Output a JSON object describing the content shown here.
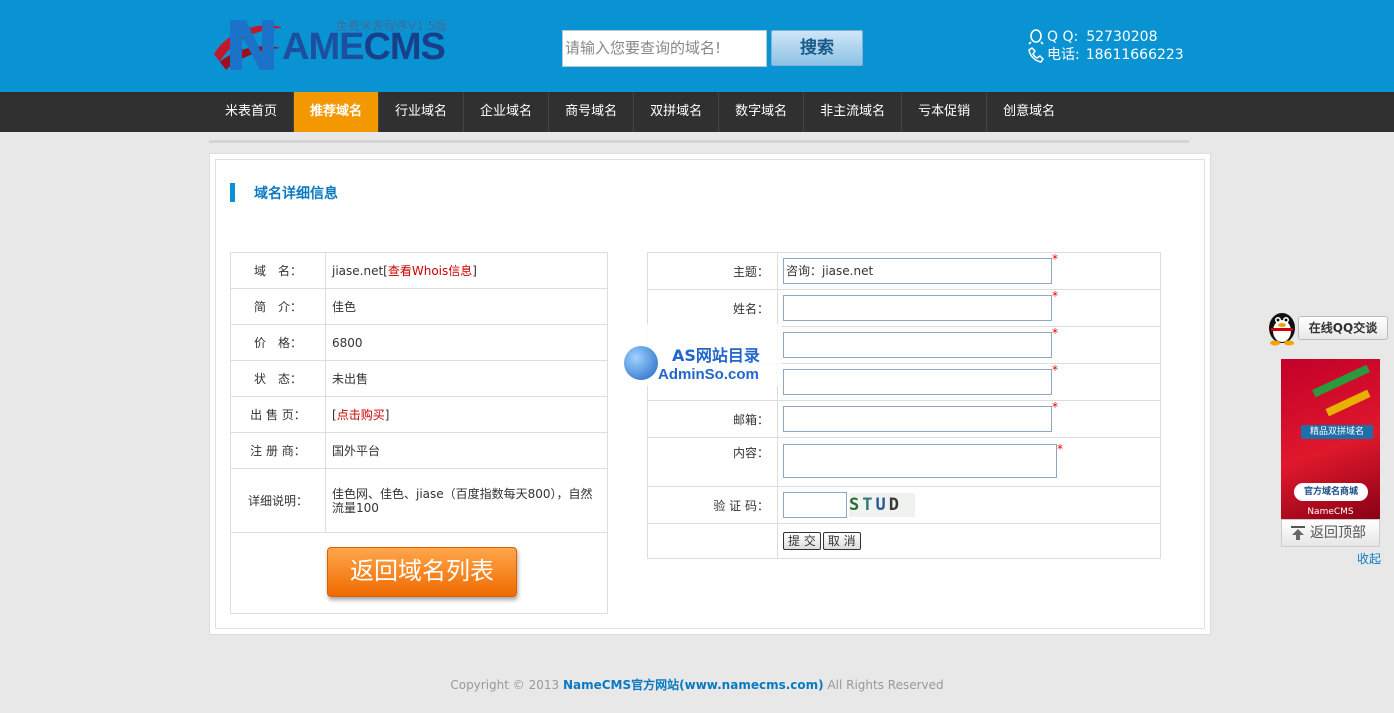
{
  "header": {
    "logo_tagline": "免费米表程序V1.5版",
    "logo_name_a": "AME",
    "logo_name_b": "CMS",
    "search_placeholder": "请输入您要查询的域名!",
    "search_button": "搜索",
    "qq_label": "Q Q:",
    "qq_number": "52730208",
    "phone_label": "电话:",
    "phone_number": "18611666223"
  },
  "nav": [
    {
      "label": "米表首页",
      "active": false
    },
    {
      "label": "推荐域名",
      "active": true
    },
    {
      "label": "行业域名",
      "active": false
    },
    {
      "label": "企业域名",
      "active": false
    },
    {
      "label": "商号域名",
      "active": false
    },
    {
      "label": "双拼域名",
      "active": false
    },
    {
      "label": "数字域名",
      "active": false
    },
    {
      "label": "非主流域名",
      "active": false
    },
    {
      "label": "亏本促销",
      "active": false
    },
    {
      "label": "创意域名",
      "active": false
    }
  ],
  "section_title": "域名详细信息",
  "info": {
    "domain_label": "域　名：",
    "domain_value": "jiase.net",
    "whois_link": "查看Whois信息",
    "intro_label": "简　介：",
    "intro_value": "佳色",
    "price_label": "价　格：",
    "price_value": "6800",
    "status_label": "状　态：",
    "status_value": "未出售",
    "sale_label": "出 售 页：",
    "sale_link": "点击购买",
    "registrar_label": "注 册 商：",
    "registrar_value": "国外平台",
    "detail_label": "详细说明：",
    "detail_value": "佳色网、佳色、jiase（百度指数每天800），自然流量100",
    "back_button": "返回域名列表"
  },
  "form": {
    "subject_label": "主题：",
    "subject_value": "咨询：jiase.net",
    "name_label": "姓名：",
    "email_label": "邮箱：",
    "content_label": "内容：",
    "captcha_label": "验 证 码：",
    "captcha_chars": [
      "S",
      "T",
      "U",
      "D"
    ],
    "required_mark": "*",
    "submit_button": "提 交",
    "cancel_button": "取 消"
  },
  "watermark": {
    "line1": "AS网站目录",
    "line2": "AdminSo.com"
  },
  "float": {
    "qq_chat_label": "在线QQ交谈",
    "ad_sign": "精品双拼域名",
    "ad_button": "官方域名商城",
    "ad_footer": "NameCMS",
    "back_to_top": "返回顶部",
    "collapse": "收起"
  },
  "footer": {
    "prefix": "Copyright © 2013 ",
    "brand": "NameCMS官方网站(www.namecms.com)",
    "suffix": " All Rights Reserved"
  },
  "colors": {
    "header_bg": "#0a93d2",
    "nav_bg": "#303030",
    "nav_active": "#f39800",
    "back_button": "#f06a00"
  }
}
